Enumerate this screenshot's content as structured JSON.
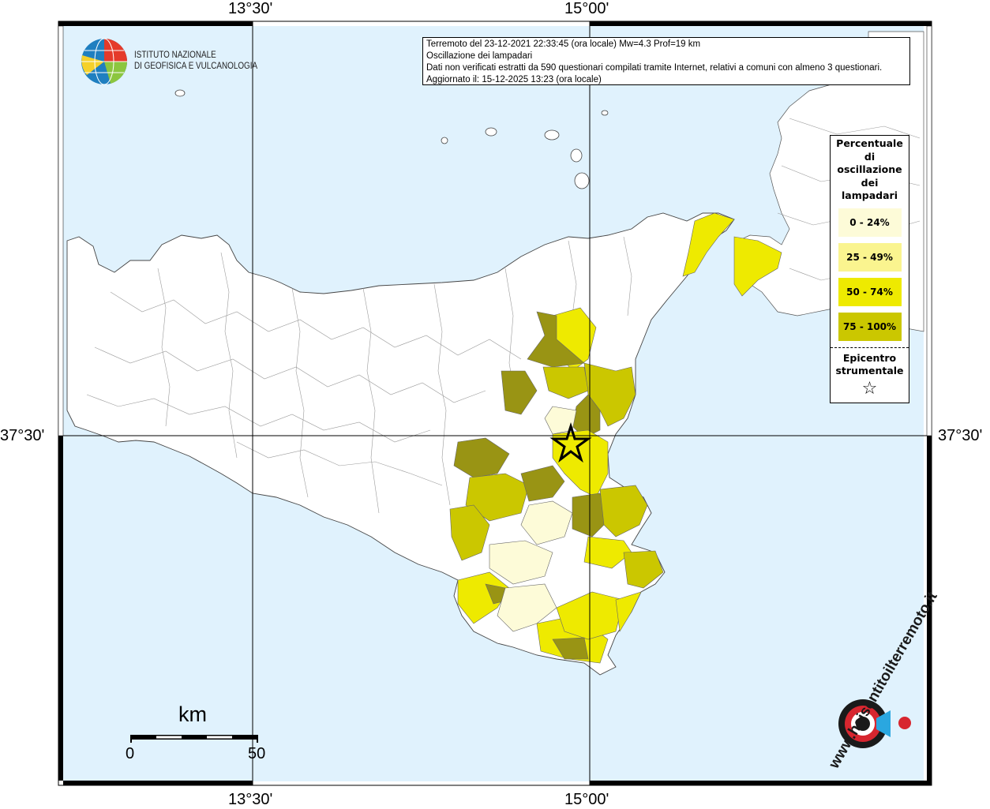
{
  "axes": {
    "lon_labels": [
      "13°30'",
      "15°00'"
    ],
    "lat_label": "37°30'"
  },
  "header": {
    "line1": "Terremoto del 23-12-2021 22:33:45 (ora locale) Mw=4.3 Prof=19 km",
    "line2": "Oscillazione dei lampadari",
    "line3": "Dati non verificati estratti da 590 questionari compilati tramite Internet, relativi a comuni con almeno 3 questionari.",
    "line4": "Aggiornato il: 15-12-2025 13:23 (ora locale)"
  },
  "logo_ingv": {
    "line1": "ISTITUTO NAZIONALE",
    "line2": "DI GEOFISICA E VULCANOLOGIA"
  },
  "legend": {
    "title_lines": [
      "Percentuale",
      "di",
      "oscillazione",
      "dei",
      "lampadari"
    ],
    "items": [
      {
        "label": "0 - 24%",
        "color": "#fdfbd8"
      },
      {
        "label": "25 - 49%",
        "color": "#faf48f"
      },
      {
        "label": "50 - 74%",
        "color": "#eeea00"
      },
      {
        "label": "75 - 100%",
        "color": "#cbc700"
      }
    ],
    "epicenter_lines": [
      "Epicentro",
      "strumentale"
    ],
    "epicenter_symbol": "☆"
  },
  "scale_bar": {
    "unit": "km",
    "start": "0",
    "end": "50"
  },
  "watermark": {
    "text": "haisentitoilterremoto.it",
    "prefix": "www."
  },
  "colors": {
    "sea": "#e0f2fd",
    "land": "#ffffff",
    "class_0_24": "#fdfbd8",
    "class_25_49": "#faf48f",
    "class_50_74": "#eeea00",
    "class_75_100": "#cbc700",
    "class_dark": "#999414"
  }
}
